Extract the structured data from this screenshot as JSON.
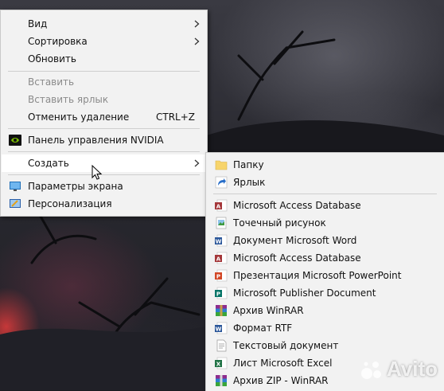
{
  "context_menu": {
    "items": [
      {
        "label": "Вид"
      },
      {
        "label": "Сортировка"
      },
      {
        "label": "Обновить"
      },
      {
        "label": "Вставить"
      },
      {
        "label": "Вставить ярлык"
      },
      {
        "label": "Отменить удаление",
        "shortcut": "CTRL+Z"
      },
      {
        "label": "Панель управления NVIDIA"
      },
      {
        "label": "Создать"
      },
      {
        "label": "Параметры экрана"
      },
      {
        "label": "Персонализация"
      }
    ]
  },
  "create_submenu": {
    "items": [
      {
        "label": "Папку",
        "icon": "folder-icon"
      },
      {
        "label": "Ярлык",
        "icon": "shortcut-icon"
      },
      {
        "label": "Microsoft Access Database",
        "icon": "access-icon"
      },
      {
        "label": "Точечный рисунок",
        "icon": "bitmap-icon"
      },
      {
        "label": "Документ Microsoft Word",
        "icon": "word-icon"
      },
      {
        "label": "Microsoft Access Database",
        "icon": "access-icon"
      },
      {
        "label": "Презентация Microsoft PowerPoint",
        "icon": "powerpoint-icon"
      },
      {
        "label": "Microsoft Publisher Document",
        "icon": "publisher-icon"
      },
      {
        "label": "Архив WinRAR",
        "icon": "winrar-icon"
      },
      {
        "label": "Формат RTF",
        "icon": "rtf-icon"
      },
      {
        "label": "Текстовый документ",
        "icon": "text-document-icon"
      },
      {
        "label": "Лист Microsoft Excel",
        "icon": "excel-icon"
      },
      {
        "label": "Архив ZIP - WinRAR",
        "icon": "zip-icon"
      }
    ]
  },
  "watermark": {
    "text": "Avito"
  },
  "colors": {
    "menu_bg": "#f2f2f2",
    "hover_bg": "#ffffff",
    "disabled_text": "#8a8a8a",
    "nvidia_green": "#76b900"
  }
}
